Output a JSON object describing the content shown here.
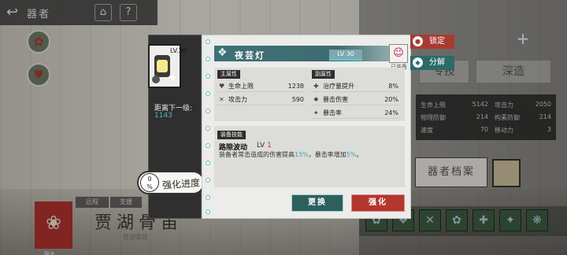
{
  "topbar": {
    "back_glyph": "↩",
    "title": "器者",
    "home_glyph": "⌂",
    "help_glyph": "?"
  },
  "background": {
    "stats": [
      {
        "name": "生命上限",
        "value": "5142"
      },
      {
        "name": "攻击力",
        "value": "2050"
      },
      {
        "name": "物理防御",
        "value": "214"
      },
      {
        "name": "构素防御",
        "value": "214"
      },
      {
        "name": "速度",
        "value": "70"
      },
      {
        "name": "移动力",
        "value": "3"
      }
    ],
    "tabs": [
      "专技",
      "深造"
    ],
    "archive_label": "器者档案",
    "role_tabs": [
      "远程",
      "支援"
    ],
    "character_name": "贾湖骨笛",
    "character_sub": "贾湖骨笛",
    "emblem_label": "锦木"
  },
  "item": {
    "level": "LV.30",
    "next_label": "距离下一级:",
    "next_value": "1143",
    "progress_percent": "0",
    "progress_unit": "%",
    "progress_label": "强化进度"
  },
  "panel": {
    "title": "夜芸灯",
    "level": "LV 30",
    "equipped": "已装备",
    "main_attr_title": "主属性",
    "sub_attr_title": "副属性",
    "main_attrs": [
      {
        "icon": "heart-icon",
        "glyph": "♥",
        "name": "生命上限",
        "value": "1238"
      },
      {
        "icon": "sword-icon",
        "glyph": "✕",
        "name": "攻击力",
        "value": "590"
      }
    ],
    "sub_attrs": [
      {
        "icon": "heal-icon",
        "glyph": "✚",
        "name": "治疗量提升",
        "value": "8%"
      },
      {
        "icon": "crit-damage-icon",
        "glyph": "✸",
        "name": "暴击伤害",
        "value": "20%"
      },
      {
        "icon": "crit-rate-icon",
        "glyph": "✦",
        "name": "暴击率",
        "value": "24%"
      }
    ],
    "skill_title": "装备技能",
    "skill_name": "路隙波动",
    "skill_lv_prefix": "LV",
    "skill_lv": "1",
    "skill_desc_a": "装备者常击造成的伤害提高",
    "skill_desc_v1": "15%",
    "skill_desc_b": "，暴击率增加",
    "skill_desc_v2": "5%",
    "skill_desc_c": "。",
    "replace_label": "更换",
    "enhance_label": "强化"
  },
  "actions": {
    "lock_label": "锁定",
    "split_label": "分解"
  },
  "colors": {
    "teal": "#3f7176",
    "red": "#b3362f",
    "highlight": "#3aa6c0"
  }
}
